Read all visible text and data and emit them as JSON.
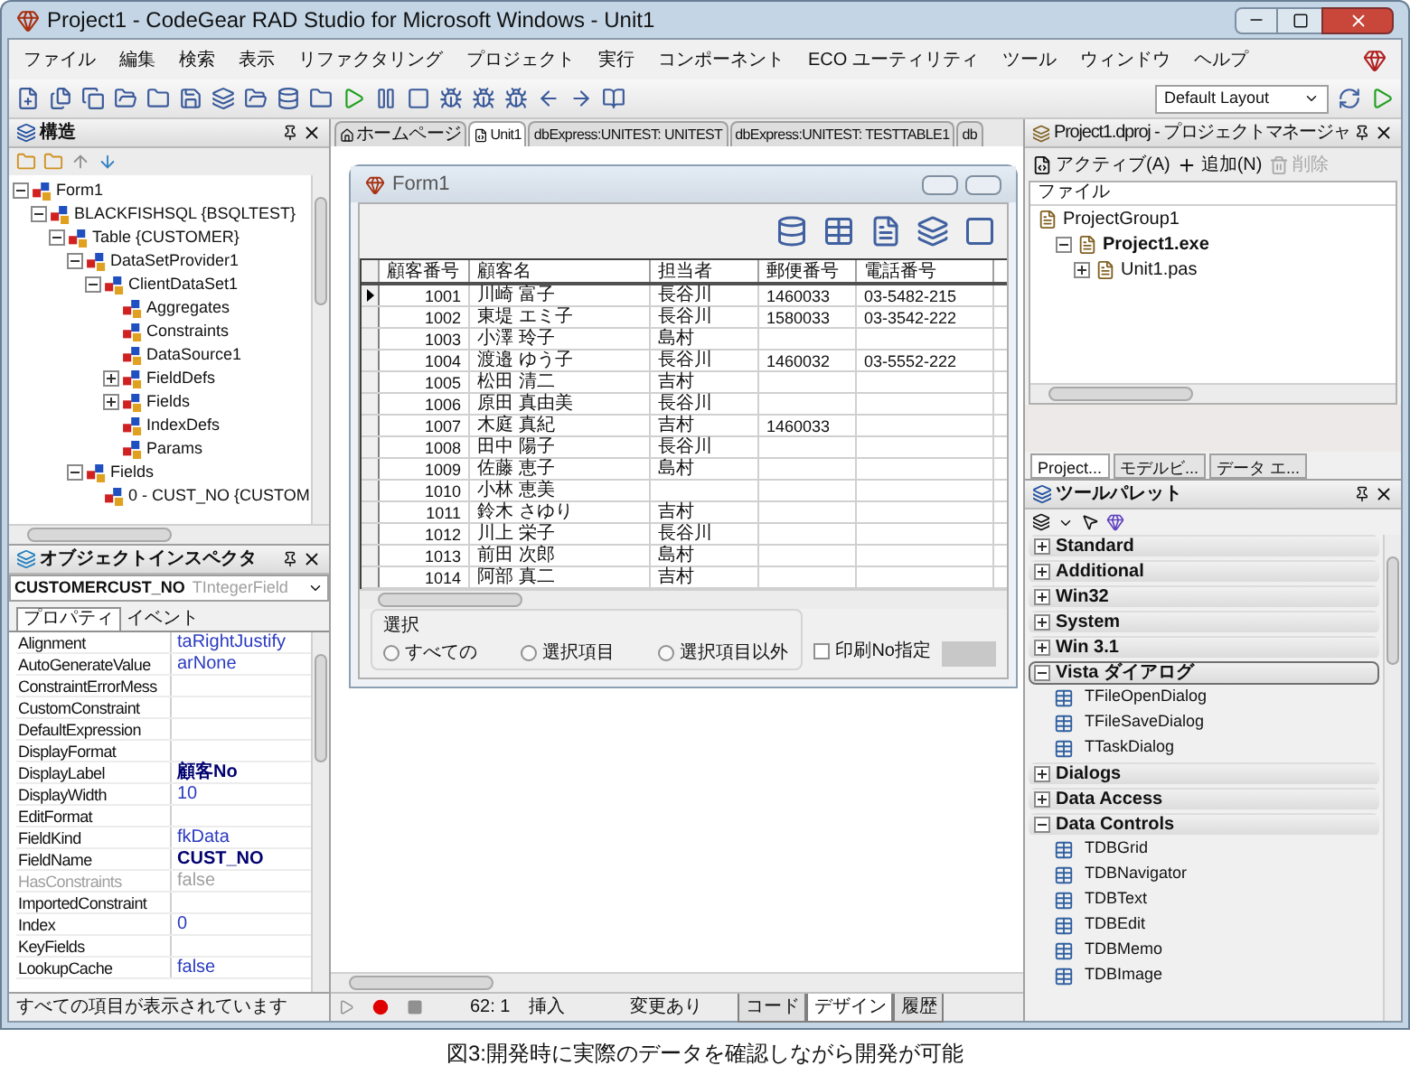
{
  "window": {
    "title": "Project1 - CodeGear RAD Studio for Microsoft Windows - Unit1"
  },
  "menu": [
    "ファイル",
    "編集",
    "検索",
    "表示",
    "リファクタリング",
    "プロジェクト",
    "実行",
    "コンポーネント",
    "ECO ユーティリティ",
    "ツール",
    "ウィンドウ",
    "ヘルプ"
  ],
  "layout_select": {
    "value": "Default Layout"
  },
  "structure": {
    "title": "構造",
    "tree": [
      {
        "label": "Form1",
        "expanded": true,
        "children": [
          {
            "label": "BLACKFISHSQL {BSQLTEST}",
            "expanded": true,
            "children": [
              {
                "label": "Table {CUSTOMER}",
                "expanded": true,
                "children": [
                  {
                    "label": "DataSetProvider1",
                    "expanded": true,
                    "children": [
                      {
                        "label": "ClientDataSet1",
                        "expanded": true,
                        "children": [
                          {
                            "label": "Aggregates"
                          },
                          {
                            "label": "Constraints"
                          },
                          {
                            "label": "DataSource1"
                          },
                          {
                            "label": "FieldDefs",
                            "expanded": false
                          },
                          {
                            "label": "Fields",
                            "expanded": false
                          },
                          {
                            "label": "IndexDefs"
                          },
                          {
                            "label": "Params"
                          }
                        ]
                      }
                    ]
                  },
                  {
                    "label": "Fields",
                    "expanded": true,
                    "children": [
                      {
                        "label": "0 - CUST_NO {CUSTOM"
                      }
                    ]
                  }
                ]
              }
            ]
          }
        ]
      }
    ]
  },
  "inspector": {
    "title": "オブジェクトインスペクタ",
    "object": "CUSTOMERCUST_NO",
    "type": "TIntegerField",
    "tabs": [
      {
        "label": "プロパティ",
        "selected": true
      },
      {
        "label": "イベント",
        "selected": false
      }
    ],
    "properties": [
      {
        "name": "Alignment",
        "value": "taRightJustify",
        "modified": false,
        "disabled": false
      },
      {
        "name": "AutoGenerateValue",
        "value": "arNone",
        "modified": false,
        "disabled": false
      },
      {
        "name": "ConstraintErrorMess",
        "disabled": false
      },
      {
        "name": "CustomConstraint",
        "disabled": false
      },
      {
        "name": "DefaultExpression",
        "disabled": false
      },
      {
        "name": "DisplayFormat",
        "disabled": false
      },
      {
        "name": "DisplayLabel",
        "value": "顧客No",
        "modified": true,
        "disabled": false
      },
      {
        "name": "DisplayWidth",
        "value": "10",
        "modified": false,
        "disabled": false
      },
      {
        "name": "EditFormat",
        "disabled": false
      },
      {
        "name": "FieldKind",
        "value": "fkData",
        "modified": false,
        "disabled": false
      },
      {
        "name": "FieldName",
        "value": "CUST_NO",
        "modified": true,
        "disabled": false
      },
      {
        "name": "HasConstraints",
        "value": "false",
        "modified": false,
        "disabled": true
      },
      {
        "name": "ImportedConstraint",
        "disabled": false
      },
      {
        "name": "Index",
        "value": "0",
        "modified": false,
        "disabled": false
      },
      {
        "name": "KeyFields",
        "disabled": false
      },
      {
        "name": "LookupCache",
        "value": "false",
        "modified": false,
        "disabled": false
      }
    ],
    "status": "すべての項目が表示されています"
  },
  "editor_tabs": [
    {
      "label": "ホームページ",
      "selected": false
    },
    {
      "label": "Unit1",
      "selected": true
    },
    {
      "label": "dbExpress:UNITEST: UNITEST",
      "selected": false
    },
    {
      "label": "dbExpress:UNITEST: TESTTABLE1",
      "selected": false
    },
    {
      "label": "db",
      "selected": false
    }
  ],
  "form": {
    "title": "Form1",
    "grid": {
      "columns": [
        "顧客番号",
        "顧客名",
        "担当者",
        "郵便番号",
        "電話番号"
      ],
      "rows": [
        {
          "selected": true,
          "cells": [
            "1001",
            "川崎 富子",
            "長谷川",
            "1460033",
            "03-5482-215"
          ]
        },
        {
          "selected": false,
          "cells": [
            "1002",
            "東堤 エミ子",
            "長谷川",
            "1580033",
            "03-3542-222"
          ]
        },
        {
          "selected": false,
          "cells": [
            "1003",
            "小澤 玲子",
            "島村",
            "",
            ""
          ]
        },
        {
          "selected": false,
          "cells": [
            "1004",
            "渡邉 ゆう子",
            "長谷川",
            "1460032",
            "03-5552-222"
          ]
        },
        {
          "selected": false,
          "cells": [
            "1005",
            "松田 清二",
            "吉村",
            "",
            ""
          ]
        },
        {
          "selected": false,
          "cells": [
            "1006",
            "原田 真由美",
            "長谷川",
            "",
            ""
          ]
        },
        {
          "selected": false,
          "cells": [
            "1007",
            "木庭 真紀",
            "吉村",
            "1460033",
            ""
          ]
        },
        {
          "selected": false,
          "cells": [
            "1008",
            "田中 陽子",
            "長谷川",
            "",
            ""
          ]
        },
        {
          "selected": false,
          "cells": [
            "1009",
            "佐藤 恵子",
            "島村",
            "",
            ""
          ]
        },
        {
          "selected": false,
          "cells": [
            "1010",
            "小林 恵美",
            "",
            "",
            ""
          ]
        },
        {
          "selected": false,
          "cells": [
            "1011",
            "鈴木 さゆり",
            "吉村",
            "",
            ""
          ]
        },
        {
          "selected": false,
          "cells": [
            "1012",
            "川上 栄子",
            "長谷川",
            "",
            ""
          ]
        },
        {
          "selected": false,
          "cells": [
            "1013",
            "前田 次郎",
            "島村",
            "",
            ""
          ]
        },
        {
          "selected": false,
          "cells": [
            "1014",
            "阿部 真二",
            "吉村",
            "",
            ""
          ]
        }
      ]
    },
    "radio_group": {
      "title": "選択",
      "options": [
        {
          "label": "すべての",
          "selected": false
        },
        {
          "label": "選択項目",
          "selected": false
        },
        {
          "label": "選択項目以外",
          "selected": false
        }
      ]
    },
    "checkbox": {
      "label": "印刷No指定",
      "checked": false
    }
  },
  "editor_status": {
    "position": "62: 1",
    "mode": "挿入",
    "modified": "変更あり"
  },
  "view_tabs": [
    {
      "label": "コード",
      "selected": false
    },
    {
      "label": "デザイン",
      "selected": true
    },
    {
      "label": "履歴",
      "selected": false
    }
  ],
  "project_manager": {
    "title": "Project1.dproj - プロジェクトマネージャ",
    "buttons": [
      {
        "label": "アクティブ(A)",
        "disabled": false
      },
      {
        "label": "追加(N)",
        "disabled": false
      },
      {
        "label": "削除",
        "disabled": true
      }
    ],
    "header": "ファイル",
    "tree": [
      {
        "label": "ProjectGroup1",
        "children": [
          {
            "label": "Project1.exe",
            "bold": true,
            "expanded": true,
            "children": [
              {
                "label": "Unit1.pas",
                "bold": false,
                "expanded": false
              }
            ]
          }
        ]
      }
    ]
  },
  "dock_tabs": [
    {
      "label": "Project...",
      "selected": true
    },
    {
      "label": "モデルビ...",
      "selected": false
    },
    {
      "label": "データ エ...",
      "selected": false
    }
  ],
  "palette": {
    "title": "ツールパレット",
    "categories": [
      {
        "label": "Standard",
        "expanded": false,
        "selected": false
      },
      {
        "label": "Additional",
        "expanded": false,
        "selected": false
      },
      {
        "label": "Win32",
        "expanded": false,
        "selected": false
      },
      {
        "label": "System",
        "expanded": false,
        "selected": false
      },
      {
        "label": "Win 3.1",
        "expanded": false,
        "selected": false
      },
      {
        "label": "Vista ダイアログ",
        "expanded": true,
        "selected": true,
        "children": [
          {
            "label": "TFileOpenDialog"
          },
          {
            "label": "TFileSaveDialog"
          },
          {
            "label": "TTaskDialog"
          }
        ]
      },
      {
        "label": "Dialogs",
        "expanded": false,
        "selected": false
      },
      {
        "label": "Data Access",
        "expanded": false,
        "selected": false
      },
      {
        "label": "Data Controls",
        "expanded": true,
        "selected": false,
        "children": [
          {
            "label": "TDBGrid"
          },
          {
            "label": "TDBNavigator"
          },
          {
            "label": "TDBText"
          },
          {
            "label": "TDBEdit"
          },
          {
            "label": "TDBMemo"
          },
          {
            "label": "TDBImage"
          }
        ]
      }
    ]
  },
  "caption": "図3:開発時に実際のデータを確認しながら開発が可能"
}
